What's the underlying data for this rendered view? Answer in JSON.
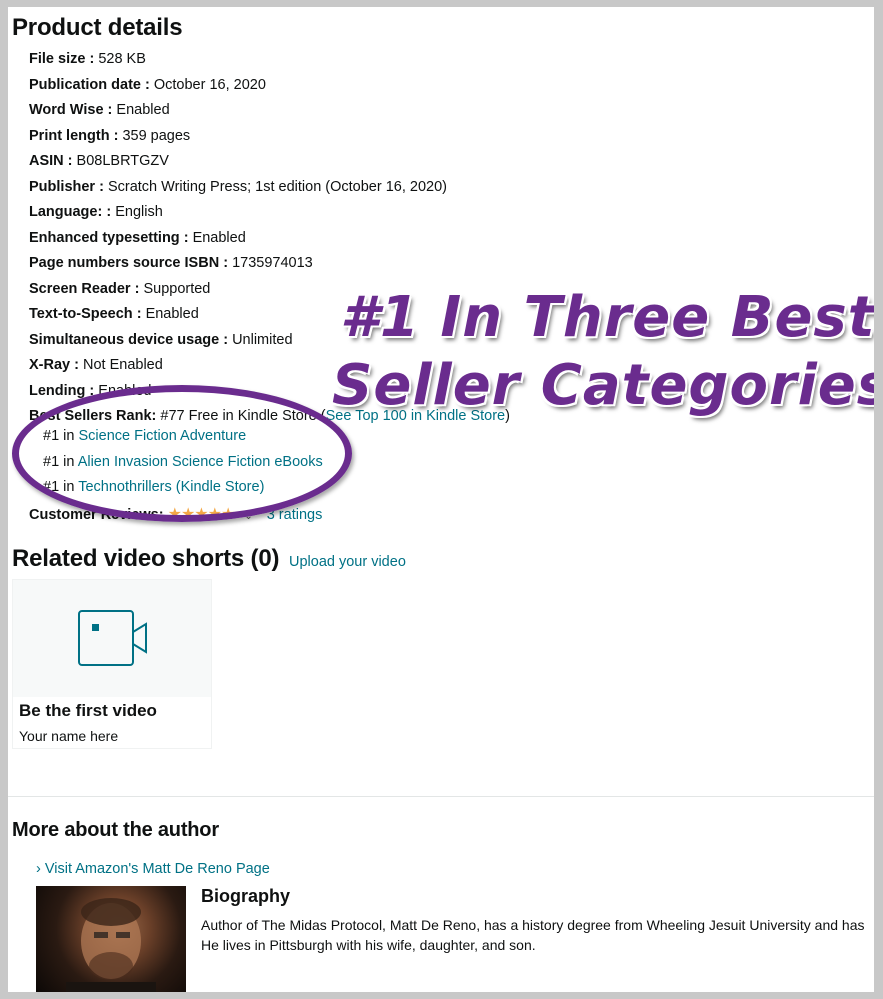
{
  "product_details": {
    "heading": "Product details",
    "rows": [
      {
        "label": "File size :",
        "value": "528 KB"
      },
      {
        "label": "Publication date :",
        "value": "October 16, 2020"
      },
      {
        "label": "Word Wise :",
        "value": "Enabled"
      },
      {
        "label": "Print length :",
        "value": "359 pages"
      },
      {
        "label": "ASIN :",
        "value": "B08LBRTGZV"
      },
      {
        "label": "Publisher :",
        "value": "Scratch Writing Press; 1st edition (October 16, 2020)"
      },
      {
        "label": "Language: :",
        "value": "English"
      },
      {
        "label": "Enhanced typesetting :",
        "value": "Enabled"
      },
      {
        "label": "Page numbers source ISBN :",
        "value": "1735974013"
      },
      {
        "label": "Screen Reader :",
        "value": "Supported"
      },
      {
        "label": "Text-to-Speech :",
        "value": "Enabled"
      },
      {
        "label": "Simultaneous device usage :",
        "value": "Unlimited"
      },
      {
        "label": "X-Ray :",
        "value": "Not Enabled"
      },
      {
        "label": "Lending :",
        "value": "Enabled"
      }
    ],
    "best_sellers": {
      "label": "Best Sellers Rank:",
      "value": "#77 Free in Kindle Store",
      "link_open": "(",
      "link": "See Top 100 in Kindle Store",
      "link_close": ")",
      "ranks": [
        {
          "prefix": "#1 in",
          "category": "Science Fiction Adventure"
        },
        {
          "prefix": "#1 in",
          "category": "Alien Invasion Science Fiction eBooks"
        },
        {
          "prefix": "#1 in",
          "category": "Technothrillers (Kindle Store)"
        }
      ]
    },
    "customer_reviews": {
      "label": "Customer Reviews:",
      "rating_stars": 5,
      "ratings_link": "3 ratings"
    }
  },
  "related_videos": {
    "heading": "Related video shorts (0)",
    "upload_link": "Upload your video",
    "card_title": "Be the first video",
    "card_sub": "Your name here",
    "icon": "video-camera-icon"
  },
  "author": {
    "heading": "More about the author",
    "page_link": "› Visit Amazon's Matt De Reno Page",
    "bio_title": "Biography",
    "bio_line1": "Author of The Midas Protocol, Matt De Reno, has a history degree from Wheeling Jesuit University and has",
    "bio_line2": "He lives in Pittsburgh with his wife, daughter, and son."
  },
  "promo": {
    "line1": "#1 In Three Best",
    "line2": "Seller Categories!",
    "color": "#6a2c8e"
  },
  "colors": {
    "link": "#007185",
    "star": "#f3a847",
    "text": "#0f1111"
  }
}
